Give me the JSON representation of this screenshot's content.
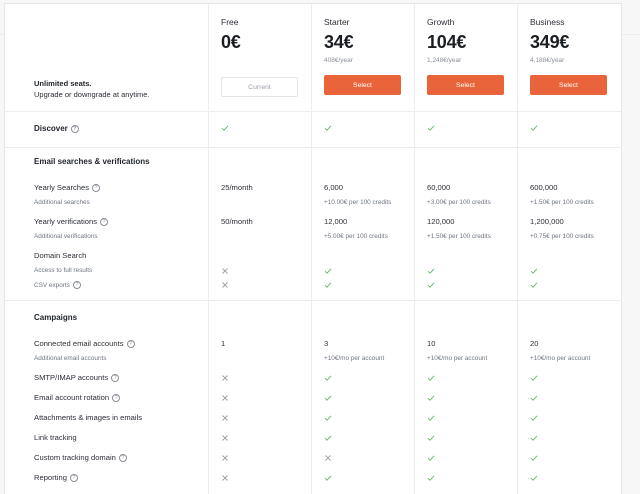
{
  "intro": {
    "line1": "Unlimited seats.",
    "line2": "Upgrade or downgrade at anytime."
  },
  "plans": [
    {
      "name": "Free",
      "price": "0€",
      "yearly": "",
      "button": "Current"
    },
    {
      "name": "Starter",
      "price": "34€",
      "yearly": "408€/year",
      "button": "Select"
    },
    {
      "name": "Growth",
      "price": "104€",
      "yearly": "1,248€/year",
      "button": "Select"
    },
    {
      "name": "Business",
      "price": "349€",
      "yearly": "4,188€/year",
      "button": "Select"
    }
  ],
  "sections": {
    "discover": "Discover",
    "email": "Email searches & verifications",
    "campaigns": "Campaigns"
  },
  "features": {
    "yearly_searches": {
      "label": "Yearly Searches",
      "sub": "Additional searches",
      "values": [
        "25/month",
        "6,000",
        "60,000",
        "600,000"
      ],
      "subs": [
        "",
        "+10.00€ per 100 credits",
        "+3.00€ per 100 credits",
        "+1.50€ per 100 credits"
      ]
    },
    "yearly_verifications": {
      "label": "Yearly verifications",
      "sub": "Additional verifications",
      "values": [
        "50/month",
        "12,000",
        "120,000",
        "1,200,000"
      ],
      "subs": [
        "",
        "+5.00€ per 100 credits",
        "+1.50€ per 100 credits",
        "+0.75€ per 100 credits"
      ]
    },
    "domain_search": {
      "label": "Domain Search"
    },
    "access_full": {
      "label": "Access to full results"
    },
    "csv_exports": {
      "label": "CSV exports"
    },
    "connected_accounts": {
      "label": "Connected email accounts",
      "sub": "Additional email accounts",
      "values": [
        "1",
        "3",
        "10",
        "20"
      ],
      "subs": [
        "",
        "+10€/mo per account",
        "+10€/mo per account",
        "+10€/mo per account"
      ]
    },
    "smtp": {
      "label": "SMTP/IMAP accounts"
    },
    "rotation": {
      "label": "Email account rotation"
    },
    "attachments": {
      "label": "Attachments & images in emails"
    },
    "link_tracking": {
      "label": "Link tracking"
    },
    "custom_domain": {
      "label": "Custom tracking domain"
    },
    "reporting": {
      "label": "Reporting"
    }
  },
  "icons": {
    "check": "check-icon",
    "cross": "cross-icon",
    "info": "info-icon",
    "info_glyph": "?"
  },
  "colors": {
    "accent": "#e9643a",
    "check": "#6bb36b",
    "cross": "#9aa0a8"
  }
}
